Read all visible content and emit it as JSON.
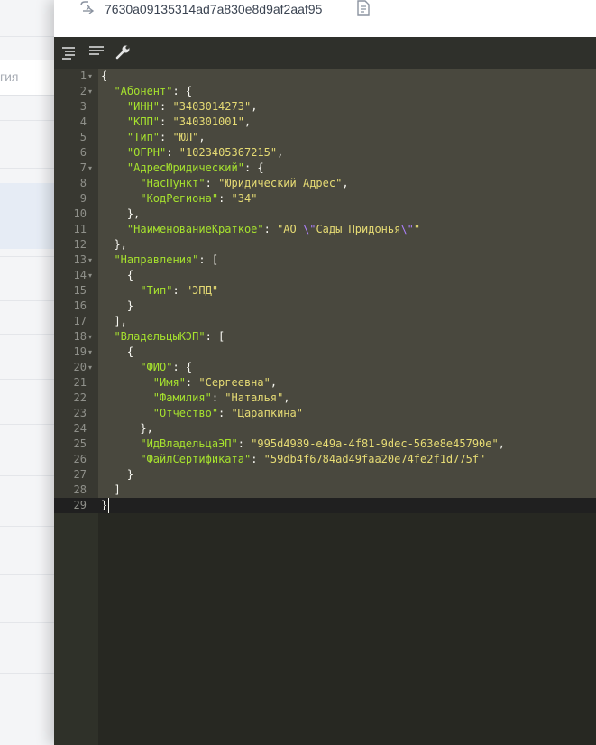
{
  "background": {
    "tab_label": "гия"
  },
  "header": {
    "document_id": "7630a09135314ad7a830e8d9af2aaf95"
  },
  "toolbar": {
    "buttons": [
      {
        "name": "format-icon"
      },
      {
        "name": "compact-icon"
      },
      {
        "name": "wrench-icon"
      }
    ]
  },
  "editor": {
    "theme": {
      "background": "#272822",
      "selection": "#49483e",
      "key_color": "#a6e22e",
      "string_color": "#e6db74",
      "escape_color": "#ae81ff",
      "punct_color": "#f8f8f2"
    },
    "lines": [
      {
        "n": "1",
        "fold": true,
        "indent": 0,
        "parts": [
          [
            "p",
            "{"
          ]
        ]
      },
      {
        "n": "2",
        "fold": true,
        "indent": 1,
        "parts": [
          [
            "k",
            "\"Абонент\""
          ],
          [
            "p",
            ": {"
          ]
        ]
      },
      {
        "n": "3",
        "fold": false,
        "indent": 2,
        "parts": [
          [
            "k",
            "\"ИНН\""
          ],
          [
            "p",
            ": "
          ],
          [
            "s",
            "\"3403014273\""
          ],
          [
            "p",
            ","
          ]
        ]
      },
      {
        "n": "4",
        "fold": false,
        "indent": 2,
        "parts": [
          [
            "k",
            "\"КПП\""
          ],
          [
            "p",
            ": "
          ],
          [
            "s",
            "\"340301001\""
          ],
          [
            "p",
            ","
          ]
        ]
      },
      {
        "n": "5",
        "fold": false,
        "indent": 2,
        "parts": [
          [
            "k",
            "\"Тип\""
          ],
          [
            "p",
            ": "
          ],
          [
            "s",
            "\"ЮЛ\""
          ],
          [
            "p",
            ","
          ]
        ]
      },
      {
        "n": "6",
        "fold": false,
        "indent": 2,
        "parts": [
          [
            "k",
            "\"ОГРН\""
          ],
          [
            "p",
            ": "
          ],
          [
            "s",
            "\"1023405367215\""
          ],
          [
            "p",
            ","
          ]
        ]
      },
      {
        "n": "7",
        "fold": true,
        "indent": 2,
        "parts": [
          [
            "k",
            "\"АдресЮридический\""
          ],
          [
            "p",
            ": {"
          ]
        ]
      },
      {
        "n": "8",
        "fold": false,
        "indent": 3,
        "parts": [
          [
            "k",
            "\"НасПункт\""
          ],
          [
            "p",
            ": "
          ],
          [
            "s",
            "\"Юридический Адрес\""
          ],
          [
            "p",
            ","
          ]
        ]
      },
      {
        "n": "9",
        "fold": false,
        "indent": 3,
        "parts": [
          [
            "k",
            "\"КодРегиона\""
          ],
          [
            "p",
            ": "
          ],
          [
            "s",
            "\"34\""
          ]
        ]
      },
      {
        "n": "10",
        "fold": false,
        "indent": 2,
        "parts": [
          [
            "p",
            "},"
          ]
        ]
      },
      {
        "n": "11",
        "fold": false,
        "indent": 2,
        "parts": [
          [
            "k",
            "\"НаименованиеКраткое\""
          ],
          [
            "p",
            ": "
          ],
          [
            "s",
            "\"АО "
          ],
          [
            "e",
            "\\\""
          ],
          [
            "s",
            "Сады Придонья"
          ],
          [
            "e",
            "\\\""
          ],
          [
            "s",
            "\""
          ]
        ]
      },
      {
        "n": "12",
        "fold": false,
        "indent": 1,
        "parts": [
          [
            "p",
            "},"
          ]
        ]
      },
      {
        "n": "13",
        "fold": true,
        "indent": 1,
        "parts": [
          [
            "k",
            "\"Направления\""
          ],
          [
            "p",
            ": ["
          ]
        ]
      },
      {
        "n": "14",
        "fold": true,
        "indent": 2,
        "parts": [
          [
            "p",
            "{"
          ]
        ]
      },
      {
        "n": "15",
        "fold": false,
        "indent": 3,
        "parts": [
          [
            "k",
            "\"Тип\""
          ],
          [
            "p",
            ": "
          ],
          [
            "s",
            "\"ЭПД\""
          ]
        ]
      },
      {
        "n": "16",
        "fold": false,
        "indent": 2,
        "parts": [
          [
            "p",
            "}"
          ]
        ]
      },
      {
        "n": "17",
        "fold": false,
        "indent": 1,
        "parts": [
          [
            "p",
            "],"
          ]
        ]
      },
      {
        "n": "18",
        "fold": true,
        "indent": 1,
        "parts": [
          [
            "k",
            "\"ВладельцыКЭП\""
          ],
          [
            "p",
            ": ["
          ]
        ]
      },
      {
        "n": "19",
        "fold": true,
        "indent": 2,
        "parts": [
          [
            "p",
            "{"
          ]
        ]
      },
      {
        "n": "20",
        "fold": true,
        "indent": 3,
        "parts": [
          [
            "k",
            "\"ФИО\""
          ],
          [
            "p",
            ": {"
          ]
        ]
      },
      {
        "n": "21",
        "fold": false,
        "indent": 4,
        "parts": [
          [
            "k",
            "\"Имя\""
          ],
          [
            "p",
            ": "
          ],
          [
            "s",
            "\"Сергеевна\""
          ],
          [
            "p",
            ","
          ]
        ]
      },
      {
        "n": "22",
        "fold": false,
        "indent": 4,
        "parts": [
          [
            "k",
            "\"Фамилия\""
          ],
          [
            "p",
            ": "
          ],
          [
            "s",
            "\"Наталья\""
          ],
          [
            "p",
            ","
          ]
        ]
      },
      {
        "n": "23",
        "fold": false,
        "indent": 4,
        "parts": [
          [
            "k",
            "\"Отчество\""
          ],
          [
            "p",
            ": "
          ],
          [
            "s",
            "\"Царапкина\""
          ]
        ]
      },
      {
        "n": "24",
        "fold": false,
        "indent": 3,
        "parts": [
          [
            "p",
            "},"
          ]
        ]
      },
      {
        "n": "25",
        "fold": false,
        "indent": 3,
        "parts": [
          [
            "k",
            "\"ИдВладельцаЭП\""
          ],
          [
            "p",
            ": "
          ],
          [
            "s",
            "\"995d4989-e49a-4f81-9dec-563e8e45790e\""
          ],
          [
            "p",
            ","
          ]
        ]
      },
      {
        "n": "26",
        "fold": false,
        "indent": 3,
        "parts": [
          [
            "k",
            "\"ФайлСертификата\""
          ],
          [
            "p",
            ": "
          ],
          [
            "s",
            "\"59db4f6784ad49faa20e74fe2f1d775f\""
          ]
        ]
      },
      {
        "n": "27",
        "fold": false,
        "indent": 2,
        "parts": [
          [
            "p",
            "}"
          ]
        ]
      },
      {
        "n": "28",
        "fold": false,
        "indent": 1,
        "parts": [
          [
            "p",
            "]"
          ]
        ]
      },
      {
        "n": "29",
        "fold": false,
        "indent": 0,
        "parts": [
          [
            "p",
            "}"
          ]
        ]
      }
    ]
  }
}
